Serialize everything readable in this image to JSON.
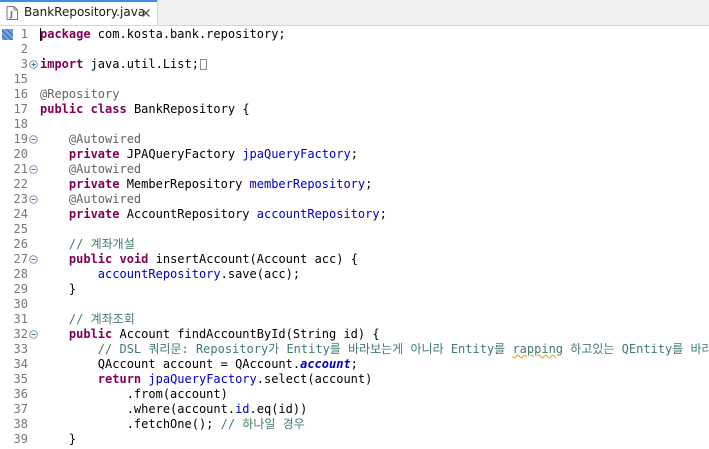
{
  "tab": {
    "title": "BankRepository.java"
  },
  "lines": [
    {
      "num": "1",
      "y": 0,
      "marker": true,
      "caret": true,
      "tokens": [
        {
          "t": "package",
          "c": "kw"
        },
        {
          "t": " com.kosta.bank.repository;",
          "c": "txt"
        }
      ]
    },
    {
      "num": "2",
      "tokens": []
    },
    {
      "num": "3",
      "fold": "expand",
      "tokens": [
        {
          "t": "import",
          "c": "kw"
        },
        {
          "t": " java.util.List;",
          "c": "txt"
        },
        {
          "t": "",
          "c": "box"
        }
      ]
    },
    {
      "num": "15",
      "tokens": []
    },
    {
      "num": "16",
      "tokens": [
        {
          "t": "@Repository",
          "c": "anno"
        }
      ]
    },
    {
      "num": "17",
      "tokens": [
        {
          "t": "public",
          "c": "kw"
        },
        {
          "t": " ",
          "c": "txt"
        },
        {
          "t": "class",
          "c": "kw"
        },
        {
          "t": " BankRepository {",
          "c": "txt"
        }
      ]
    },
    {
      "num": "18",
      "tokens": []
    },
    {
      "num": "19",
      "fold": "collapse",
      "tokens": [
        {
          "t": "    @Autowired",
          "c": "anno"
        }
      ]
    },
    {
      "num": "20",
      "tokens": [
        {
          "t": "    ",
          "c": "txt"
        },
        {
          "t": "private",
          "c": "kw"
        },
        {
          "t": " JPAQueryFactory ",
          "c": "txt"
        },
        {
          "t": "jpaQueryFactory",
          "c": "field"
        },
        {
          "t": ";",
          "c": "txt"
        }
      ]
    },
    {
      "num": "21",
      "fold": "collapse",
      "tokens": [
        {
          "t": "    @Autowired",
          "c": "anno"
        }
      ]
    },
    {
      "num": "22",
      "tokens": [
        {
          "t": "    ",
          "c": "txt"
        },
        {
          "t": "private",
          "c": "kw"
        },
        {
          "t": " MemberRepository ",
          "c": "txt"
        },
        {
          "t": "memberRepository",
          "c": "field"
        },
        {
          "t": ";",
          "c": "txt"
        }
      ]
    },
    {
      "num": "23",
      "fold": "collapse",
      "tokens": [
        {
          "t": "    @Autowired",
          "c": "anno"
        }
      ]
    },
    {
      "num": "24",
      "tokens": [
        {
          "t": "    ",
          "c": "txt"
        },
        {
          "t": "private",
          "c": "kw"
        },
        {
          "t": " AccountRepository ",
          "c": "txt"
        },
        {
          "t": "accountRepository",
          "c": "field"
        },
        {
          "t": ";",
          "c": "txt"
        }
      ]
    },
    {
      "num": "25",
      "tokens": []
    },
    {
      "num": "26",
      "tokens": [
        {
          "t": "    // 계좌개설",
          "c": "cmt"
        }
      ]
    },
    {
      "num": "27",
      "fold": "collapse",
      "tokens": [
        {
          "t": "    ",
          "c": "txt"
        },
        {
          "t": "public",
          "c": "kw"
        },
        {
          "t": " ",
          "c": "txt"
        },
        {
          "t": "void",
          "c": "kw"
        },
        {
          "t": " insertAccount(Account acc) {",
          "c": "txt"
        }
      ]
    },
    {
      "num": "28",
      "tokens": [
        {
          "t": "        ",
          "c": "txt"
        },
        {
          "t": "accountRepository",
          "c": "field"
        },
        {
          "t": ".save(acc);",
          "c": "txt"
        }
      ]
    },
    {
      "num": "29",
      "tokens": [
        {
          "t": "    }",
          "c": "txt"
        }
      ]
    },
    {
      "num": "30",
      "tokens": []
    },
    {
      "num": "31",
      "tokens": [
        {
          "t": "    // 계좌조회",
          "c": "cmt"
        }
      ]
    },
    {
      "num": "32",
      "fold": "collapse",
      "tokens": [
        {
          "t": "    ",
          "c": "txt"
        },
        {
          "t": "public",
          "c": "kw"
        },
        {
          "t": " Account findAccountById(String id) {",
          "c": "txt"
        }
      ]
    },
    {
      "num": "33",
      "tokens": [
        {
          "t": "        // DSL 쿼리문: Repository가 Entity를 바라보는게 아니라 Entity를 ",
          "c": "cmt"
        },
        {
          "t": "rapping",
          "c": "cmt-sq"
        },
        {
          "t": " 하고있는 QEntity를 바라본다.",
          "c": "cmt"
        }
      ]
    },
    {
      "num": "34",
      "tokens": [
        {
          "t": "        QAccount account = QAccount.",
          "c": "txt"
        },
        {
          "t": "account",
          "c": "field-it"
        },
        {
          "t": ";",
          "c": "txt"
        }
      ]
    },
    {
      "num": "35",
      "tokens": [
        {
          "t": "        ",
          "c": "txt"
        },
        {
          "t": "return",
          "c": "kw"
        },
        {
          "t": " ",
          "c": "txt"
        },
        {
          "t": "jpaQueryFactory",
          "c": "field"
        },
        {
          "t": ".select(account)",
          "c": "txt"
        }
      ]
    },
    {
      "num": "36",
      "tokens": [
        {
          "t": "            .from(account)",
          "c": "txt"
        }
      ]
    },
    {
      "num": "37",
      "tokens": [
        {
          "t": "            .where(account.",
          "c": "txt"
        },
        {
          "t": "id",
          "c": "field"
        },
        {
          "t": ".eq(id))",
          "c": "txt"
        }
      ]
    },
    {
      "num": "38",
      "tokens": [
        {
          "t": "            .fetchOne(); ",
          "c": "txt"
        },
        {
          "t": "// 하나일 경우",
          "c": "cmt"
        }
      ]
    },
    {
      "num": "39",
      "tokens": [
        {
          "t": "    }",
          "c": "txt"
        }
      ]
    }
  ],
  "colors": {
    "keyword": "#7f0055",
    "annotation": "#646464",
    "field": "#0000c0",
    "comment": "#3f7f5f",
    "line_number": "#787878",
    "tab_accent": "#3b8ee8"
  }
}
